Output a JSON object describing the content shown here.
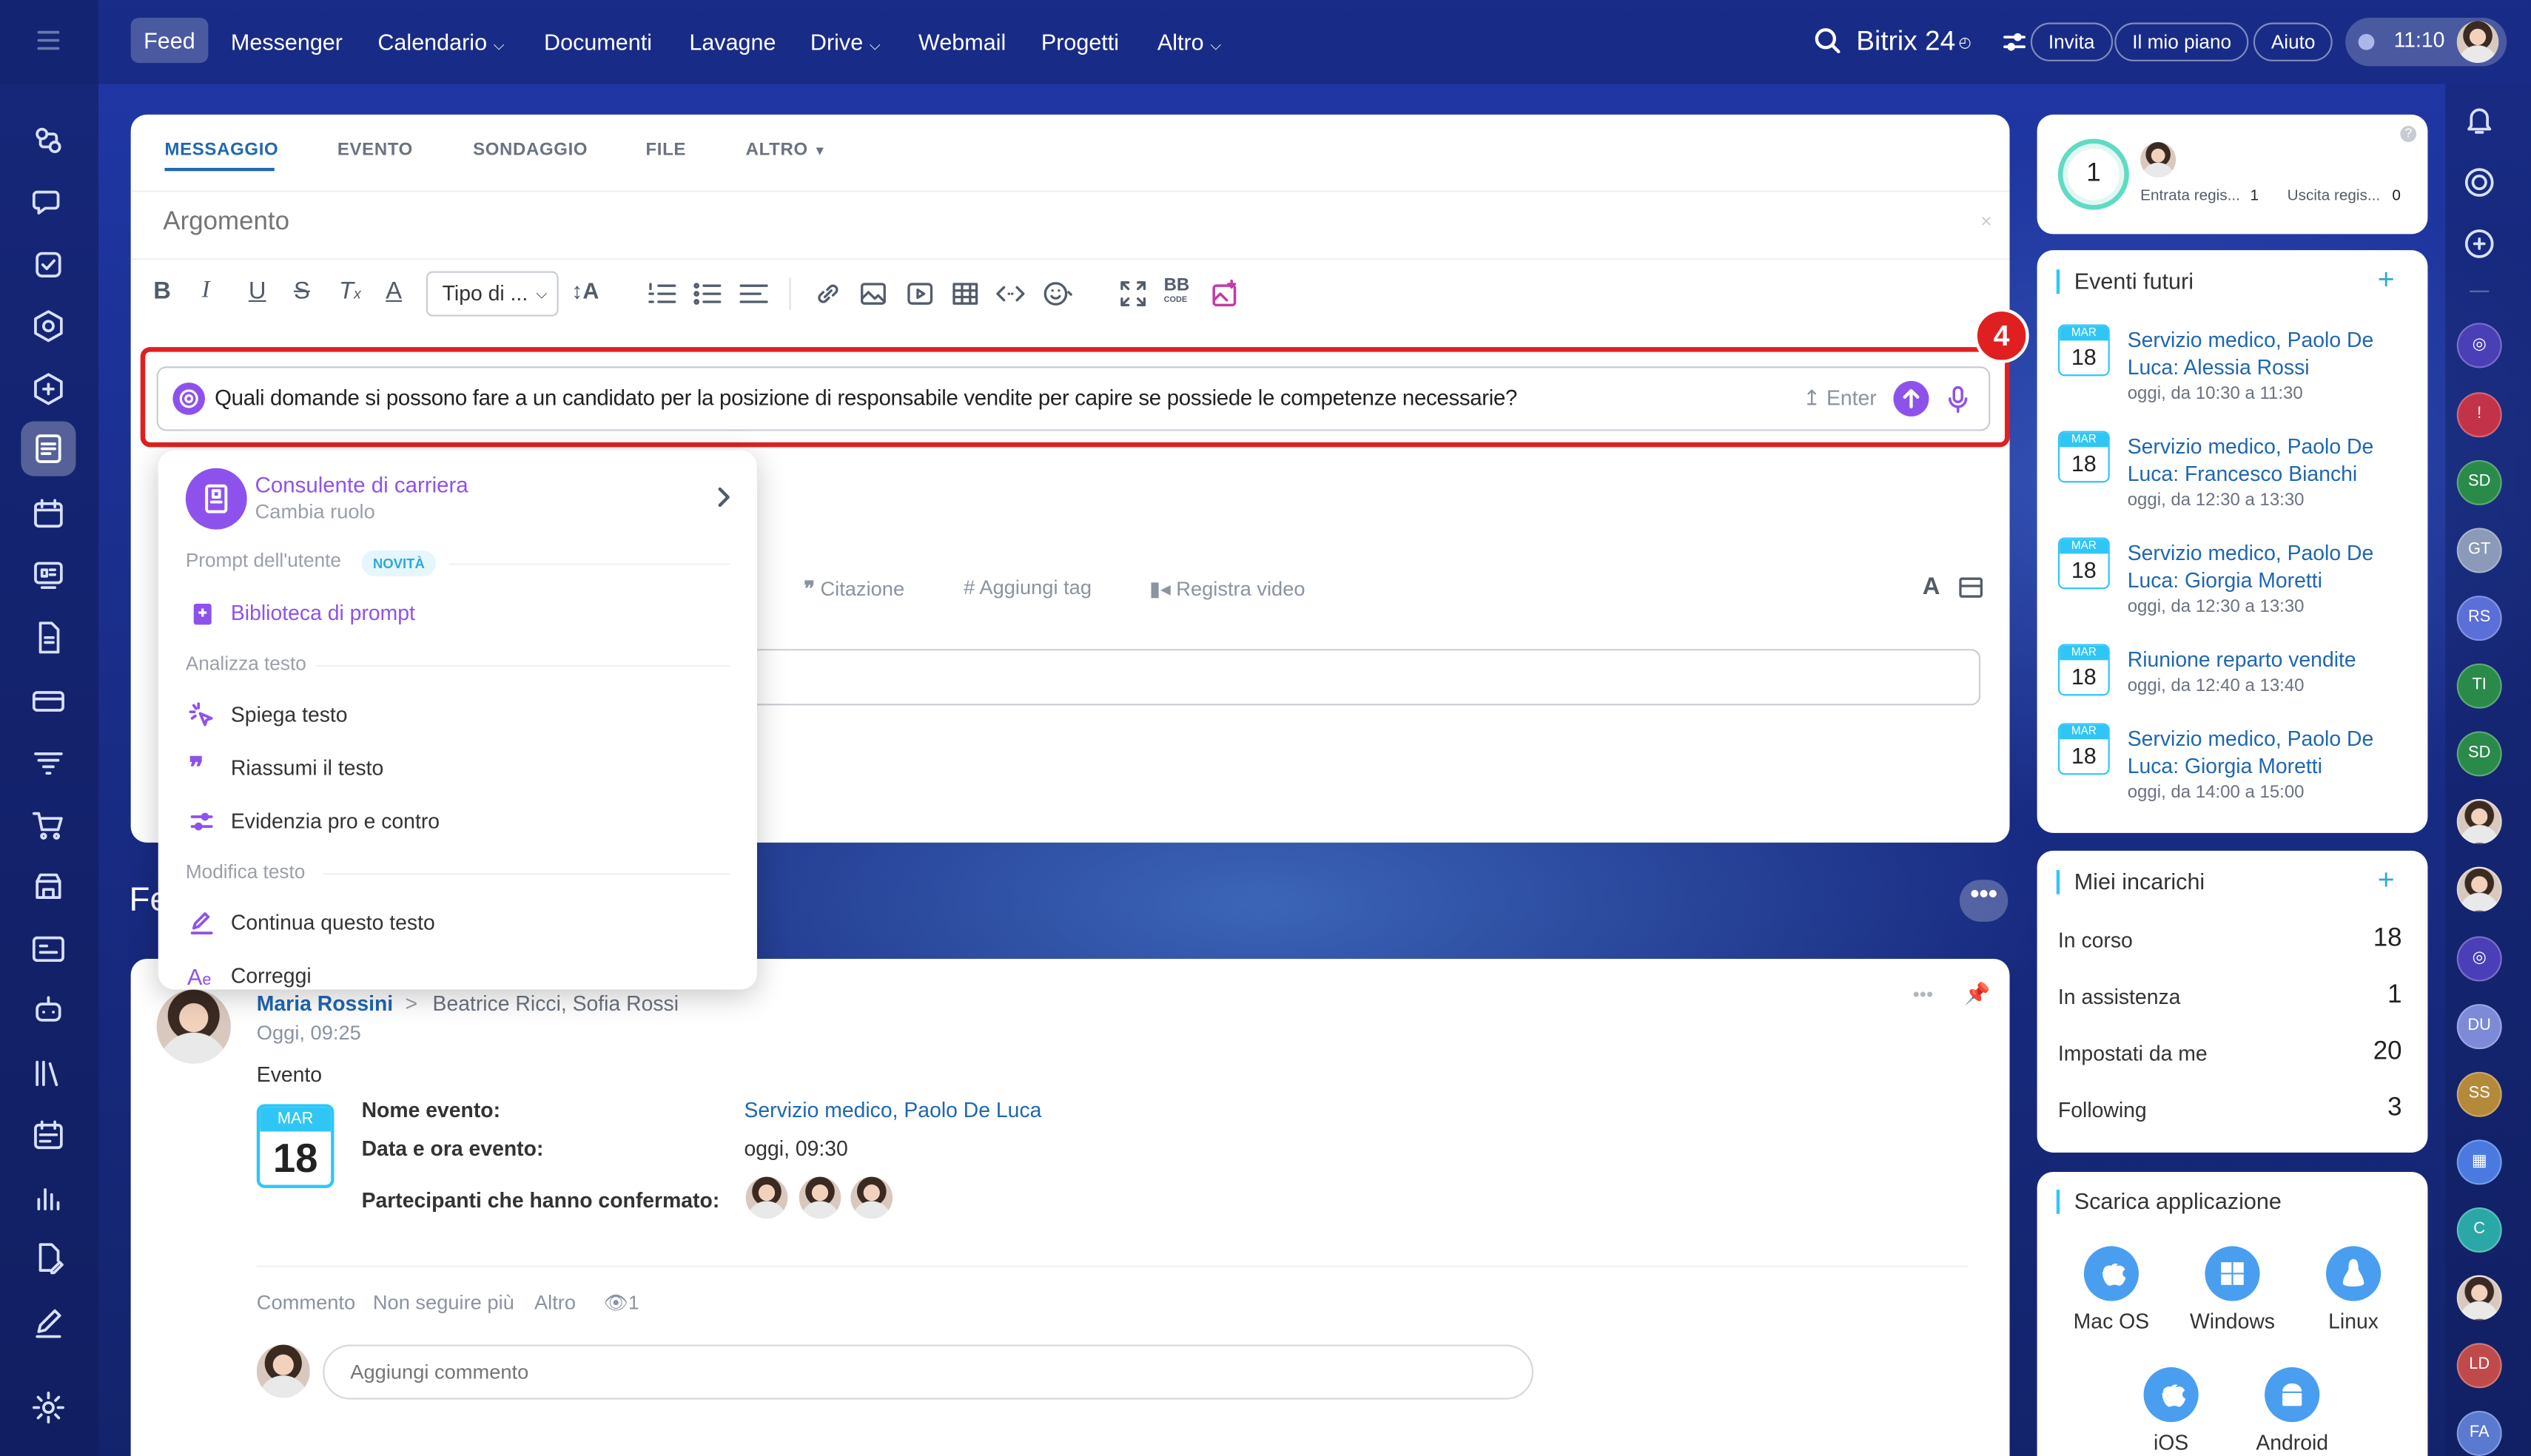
{
  "topnav": {
    "feed": "Feed",
    "messenger": "Messenger",
    "calendario": "Calendario",
    "documenti": "Documenti",
    "lavagne": "Lavagne",
    "drive": "Drive",
    "webmail": "Webmail",
    "progetti": "Progetti",
    "altro": "Altro"
  },
  "header": {
    "brand": "Bitrix 24",
    "invite": "Invita",
    "plan": "Il mio piano",
    "help": "Aiuto",
    "time": "11:10"
  },
  "composer": {
    "tabs": [
      "MESSAGGIO",
      "EVENTO",
      "SONDAGGIO",
      "FILE",
      "ALTRO"
    ],
    "subject_placeholder": "Argomento",
    "format_select": "Tipo di ...",
    "bbcode": "BB",
    "bbcode_sub": "CODE"
  },
  "ai_prompt": {
    "text": "Quali domande si possono fare a un candidato per la posizione di responsabile vendite per capire se possiede le competenze necessarie?",
    "enter_label": "Enter",
    "step_badge": "4"
  },
  "ai_menu": {
    "role_title": "Consulente di carriera",
    "role_sub": "Cambia ruolo",
    "user_prompts_label": "Prompt dell'utente",
    "new_badge": "NOVITÀ",
    "library": "Biblioteca di prompt",
    "analyze_label": "Analizza testo",
    "explain": "Spiega testo",
    "summarize": "Riassumi il testo",
    "pros_cons": "Evidenzia pro e contro",
    "modify_label": "Modifica testo",
    "continue": "Continua questo testo",
    "correct": "Correggi"
  },
  "composer_footer": {
    "quote": "Citazione",
    "add_tag": "Aggiungi tag",
    "record_video": "Registra video",
    "font_letter": "A"
  },
  "feed": {
    "heading_partial": "Fe",
    "post": {
      "author": "Maria Rossini",
      "recipients": "Beatrice Ricci, Sofia Rossi",
      "time": "Oggi, 09:25",
      "type": "Evento",
      "cal_month": "MAR",
      "cal_day": "18",
      "name_label": "Nome evento:",
      "name_value": "Servizio medico, Paolo De Luca",
      "date_label": "Data e ora evento:",
      "date_value": "oggi, 09:30",
      "participants_label": "Partecipanti che hanno confermato:",
      "actions": [
        "Commento",
        "Non seguire più",
        "Altro"
      ],
      "views": "1",
      "comment_placeholder": "Aggiungi commento"
    }
  },
  "timeman": {
    "counter": "1",
    "in_label": "Entrata regis...",
    "in_value": "1",
    "out_label": "Uscita regis...",
    "out_value": "0"
  },
  "events": {
    "title": "Eventi futuri",
    "items": [
      {
        "month": "MAR",
        "day": "18",
        "title": "Servizio medico, Paolo De Luca: Alessia Rossi",
        "time": "oggi, da 10:30 a 11:30"
      },
      {
        "month": "MAR",
        "day": "18",
        "title": "Servizio medico, Paolo De Luca: Francesco Bianchi",
        "time": "oggi, da 12:30 a 13:30"
      },
      {
        "month": "MAR",
        "day": "18",
        "title": "Servizio medico, Paolo De Luca: Giorgia Moretti",
        "time": "oggi, da 12:30 a 13:30"
      },
      {
        "month": "MAR",
        "day": "18",
        "title": "Riunione reparto vendite",
        "time": "oggi, da 12:40 a 13:40"
      },
      {
        "month": "MAR",
        "day": "18",
        "title": "Servizio medico, Paolo De Luca: Giorgia Moretti",
        "time": "oggi, da 14:00 a 15:00"
      }
    ]
  },
  "tasks": {
    "title": "Miei incarichi",
    "rows": [
      {
        "label": "In corso",
        "value": "18"
      },
      {
        "label": "In assistenza",
        "value": "1"
      },
      {
        "label": "Impostati da me",
        "value": "20"
      },
      {
        "label": "Following",
        "value": "3"
      }
    ]
  },
  "apps": {
    "title": "Scarica applicazione",
    "items": [
      "Mac OS",
      "Windows",
      "Linux",
      "iOS",
      "Android"
    ]
  },
  "right_avatars": [
    "SD",
    "GT",
    "RS",
    "TI",
    "SD",
    "DU",
    "SS",
    "C",
    "LD",
    "FA"
  ],
  "colors": {
    "accent": "#2067b0",
    "ai_purple": "#8e52ec",
    "highlight_red": "#e02020",
    "calendar_blue": "#2fc6f6"
  }
}
